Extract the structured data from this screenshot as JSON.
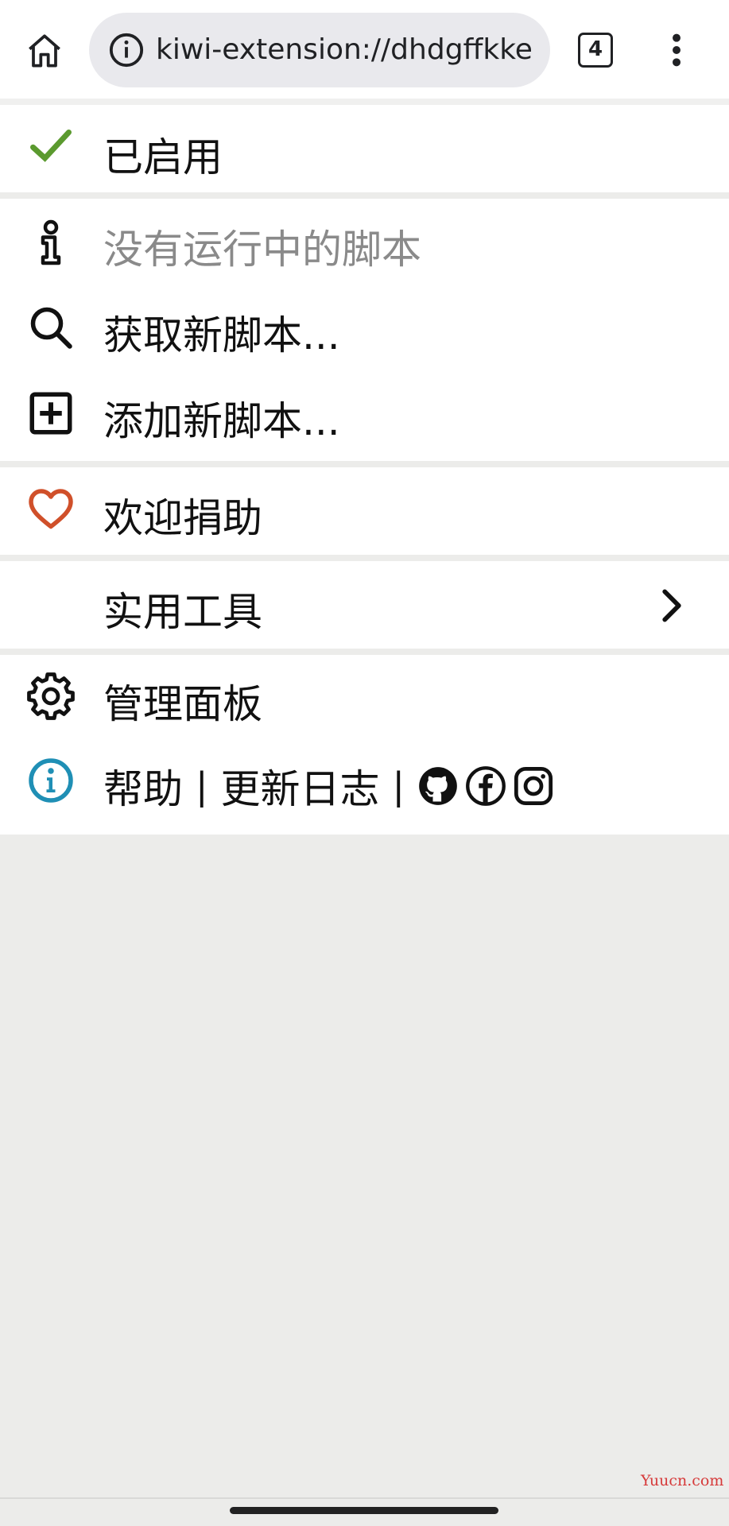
{
  "browser": {
    "url": "kiwi-extension://dhdgffkke",
    "tab_count": "4"
  },
  "menu": {
    "enabled_label": "已启用",
    "no_scripts_label": "没有运行中的脚本",
    "get_new_script_label": "获取新脚本...",
    "add_new_script_label": "添加新脚本...",
    "donate_label": "欢迎捐助",
    "utilities_label": "实用工具",
    "dashboard_label": "管理面板",
    "help_label": "帮助",
    "separator": "|",
    "changelog_label": "更新日志"
  },
  "colors": {
    "check_green": "#5b9a2f",
    "heart_red": "#d0502a",
    "info_teal": "#1f8fb5"
  },
  "watermark": "Yuucn.com"
}
